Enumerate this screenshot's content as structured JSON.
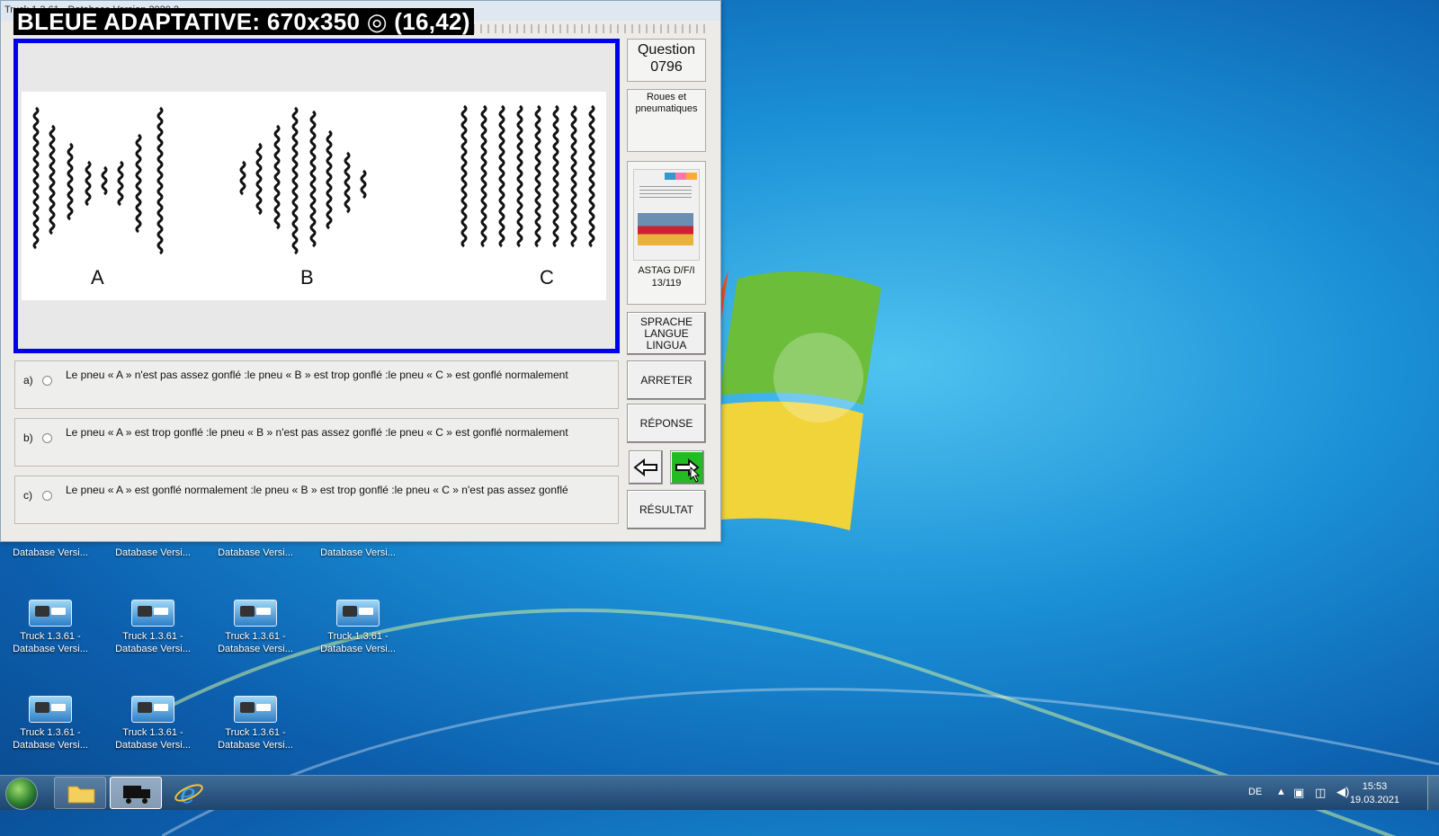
{
  "window": {
    "title": "Truck 1.3.61 - Database Version 2020.2",
    "overlay_label": "BLEUE ADAPTATIVE: 670x350 ◎ (16,42)"
  },
  "image": {
    "tire_labels": [
      "A",
      "B",
      "C"
    ]
  },
  "sidebar": {
    "question_label": "Question",
    "question_number": "0796",
    "category": "Roues et pneumatiques",
    "book_caption": "ASTAG D/F/I",
    "book_page": "13/119"
  },
  "answers": [
    {
      "letter": "a)",
      "text": "Le pneu « A » n'est pas assez gonflé :le pneu « B » est trop gonflé :le pneu « C » est gonflé normalement"
    },
    {
      "letter": "b)",
      "text": "Le pneu « A » est trop gonflé :le pneu « B » n'est pas assez gonflé :le pneu « C » est gonflé normalement"
    },
    {
      "letter": "c)",
      "text": "Le pneu « A » est gonflé normalement :le pneu « B » est trop gonflé :le pneu « C » n'est pas assez gonflé"
    }
  ],
  "buttons": {
    "language_line1": "SPRACHE",
    "language_line2": "LANGUE",
    "language_line3": "LINGUA",
    "stop": "ARRETER",
    "answer": "RÉPONSE",
    "result": "RÉSULTAT"
  },
  "desktop_icons": {
    "cut_label": "Database Versi...",
    "label_line1": "Truck 1.3.61 -",
    "label_line2": "Database Versi..."
  },
  "taskbar": {
    "language": "DE",
    "time": "15:53",
    "date": "19.03.2021"
  },
  "colors": {
    "frame_border": "#0000ee",
    "next_button": "#22bb22",
    "desktop": "#1a8fd6"
  }
}
